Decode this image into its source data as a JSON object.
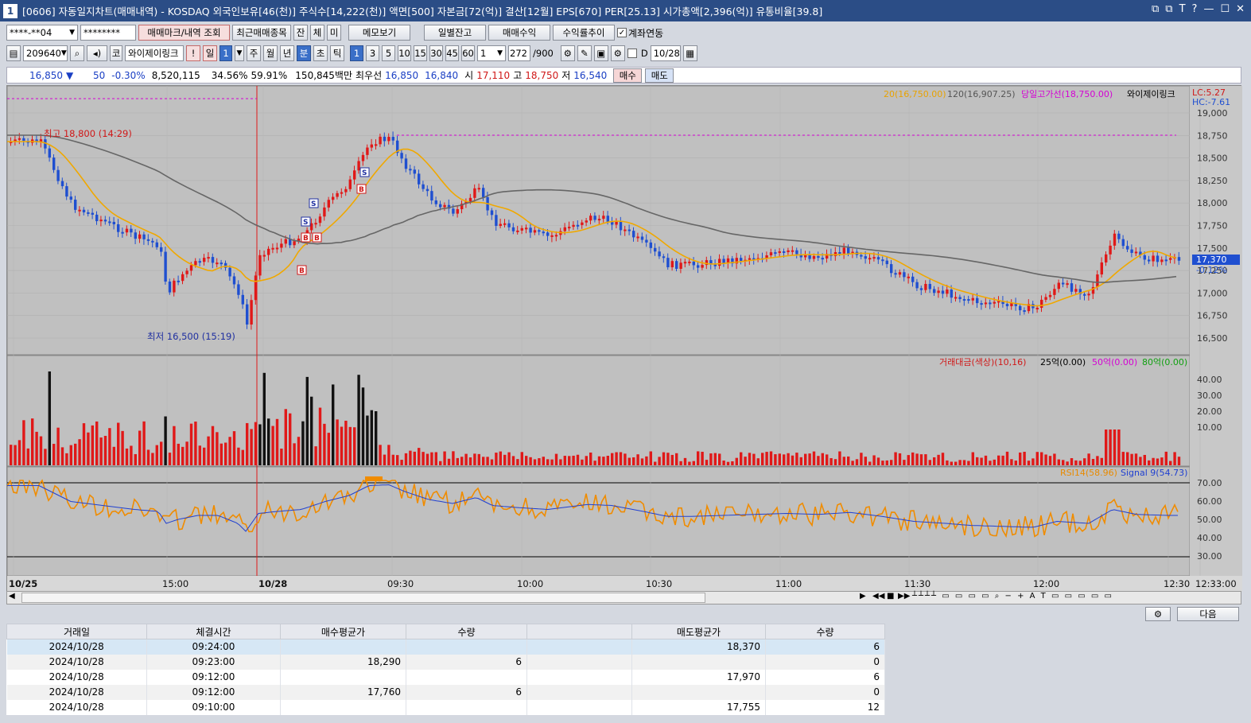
{
  "window": {
    "number": "1",
    "title": "[0606] 자동일지차트(매매내역) - KOSDAQ 외국인보유[46(천)] 주식수[14,222(천)] 액면[500] 자본금[72(억)] 결산[12월] EPS[670] PER[25.13] 시가총액[2,396(억)] 유통비율[39.8]",
    "controls": [
      "⧉",
      "⧉",
      "T",
      "?",
      "—",
      "☐",
      "✕"
    ]
  },
  "toolbar1": {
    "account": "****-**04",
    "password": "********",
    "buttons": [
      "매매마크/내역 조회",
      "최근매매종목",
      "잔",
      "체",
      "미",
      "메모보기",
      "일별잔고",
      "매매수익",
      "수익률추이"
    ],
    "account_link_label": "계좌연동",
    "account_link_checked": true
  },
  "toolbar2": {
    "code": "209640",
    "market": "코",
    "name": "와이제이링크",
    "period_buttons": [
      "!",
      "일",
      "1",
      "주",
      "월",
      "년",
      "분",
      "초",
      "틱"
    ],
    "minute_buttons": [
      "1",
      "3",
      "5",
      "10",
      "15",
      "30",
      "45",
      "60"
    ],
    "interval": "1",
    "count": "272",
    "count_total": "/900",
    "date": "10/28",
    "d_label": "D"
  },
  "quote": {
    "price": "16,850",
    "arrow": "▼",
    "change": "50",
    "change_pct": "-0.30%",
    "volume": "8,520,115",
    "pct1": "34.56%",
    "pct2": "59.91%",
    "amount": "150,845백만",
    "best_label": "최우선",
    "best_bid": "16,850",
    "best_ask": "16,840",
    "open_label": "시",
    "open": "17,110",
    "high_label": "고",
    "high": "18,750",
    "low_label": "저",
    "low": "16,540",
    "buy_button": "매수",
    "sell_button": "매도"
  },
  "price_panel": {
    "legend": [
      {
        "text": "20(16,750.00)",
        "color": "#e8a200"
      },
      {
        "text": "120(16,907.25)",
        "color": "#555555"
      },
      {
        "text": "당일고가선(18,750.00)",
        "color": "#d400d4"
      },
      {
        "text": "와이제이링크",
        "color": "#000000"
      }
    ],
    "lc": "LC:5.27",
    "hc": "HC:-7.61",
    "current_price_tag": "17,370",
    "current_pct_tag": "-0.12%",
    "y_ticks": [
      "19,000",
      "18,750",
      "18,500",
      "18,250",
      "18,000",
      "17,750",
      "17,500",
      "17,250",
      "17,000",
      "16,750",
      "16,500"
    ],
    "high_annotation": "최고 18,800 (14:29)",
    "low_annotation": "최저 16,500 (15:19)",
    "trade_marks": [
      {
        "type": "S",
        "time": "09:24"
      },
      {
        "type": "B",
        "time": "09:23"
      },
      {
        "type": "S",
        "time": "09:12"
      },
      {
        "type": "B",
        "time": "09:12"
      },
      {
        "type": "S",
        "time": "09:10"
      },
      {
        "type": "B",
        "time": "09:10"
      },
      {
        "type": "B",
        "time": "09:08"
      }
    ]
  },
  "volume_panel": {
    "legend": [
      {
        "text": "거래대금(색상)(10,16)",
        "color": "#d01818"
      },
      {
        "text": "25억(0.00)",
        "color": "#000000"
      },
      {
        "text": "50억(0.00)",
        "color": "#d400d4"
      },
      {
        "text": "80억(0.00)",
        "color": "#10a010"
      }
    ],
    "y_ticks": [
      "40.00",
      "30.00",
      "20.00",
      "10.00"
    ]
  },
  "rsi_panel": {
    "legend": [
      {
        "text": "RSI14(58.96)",
        "color": "#e88a00"
      },
      {
        "text": "Signal 9(54.73)",
        "color": "#2040d0"
      }
    ],
    "y_ticks": [
      "70.00",
      "60.00",
      "50.00",
      "40.00",
      "30.00"
    ]
  },
  "x_axis": [
    "10/25",
    "15:00",
    "10/28",
    "09:30",
    "10:00",
    "10:30",
    "11:00",
    "11:30",
    "12:00",
    "12:30",
    "12:33:00"
  ],
  "bottom_bar": {
    "next_button": "다음"
  },
  "trades_table": {
    "headers": [
      "거래일",
      "체결시간",
      "매수평균가",
      "수량",
      "",
      "매도평균가",
      "수량"
    ],
    "rows": [
      [
        "2024/10/28",
        "09:24:00",
        "",
        "",
        "",
        "18,370",
        "6"
      ],
      [
        "2024/10/28",
        "09:23:00",
        "18,290",
        "6",
        "",
        "",
        "0"
      ],
      [
        "2024/10/28",
        "09:12:00",
        "",
        "",
        "",
        "17,970",
        "6"
      ],
      [
        "2024/10/28",
        "09:12:00",
        "17,760",
        "6",
        "",
        "",
        "0"
      ],
      [
        "2024/10/28",
        "09:10:00",
        "",
        "",
        "",
        "17,755",
        "12"
      ]
    ]
  },
  "colors": {
    "up": "#e01818",
    "down": "#1f4fd0",
    "ma20": "#f0a800",
    "ma120": "#666666",
    "rsi": "#f08c00",
    "signal": "#2040d0",
    "chart_bg": "#c0c0c0"
  }
}
